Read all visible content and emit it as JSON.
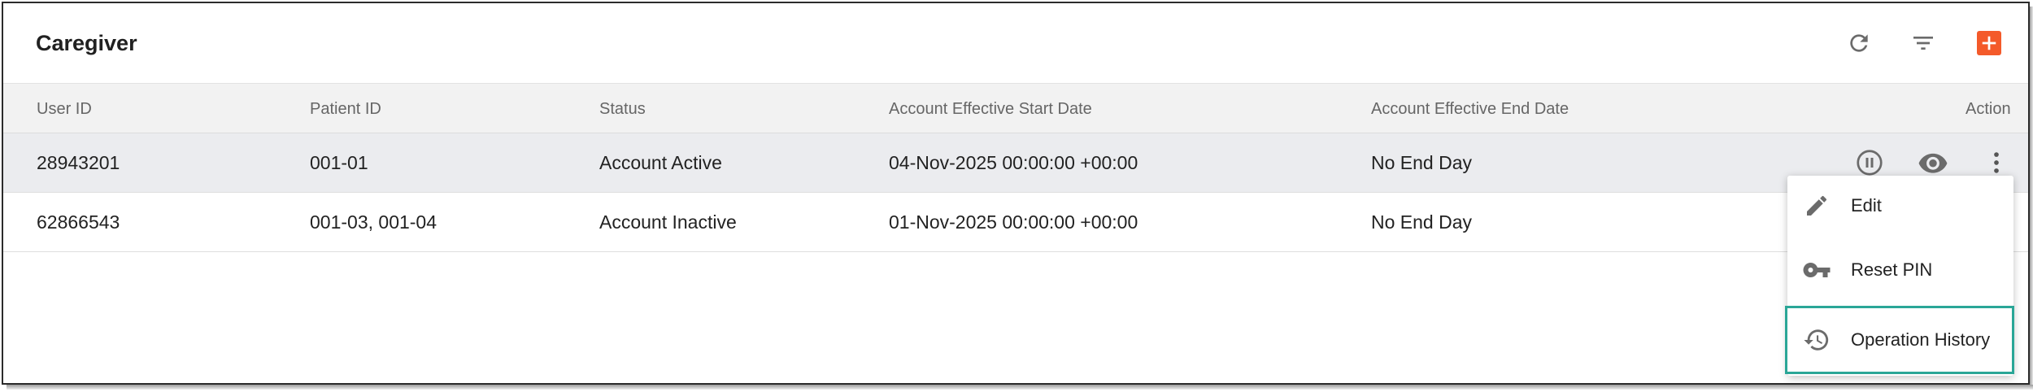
{
  "header": {
    "title": "Caregiver",
    "icons": [
      "refresh-icon",
      "filter-icon",
      "add-icon"
    ],
    "accent_color": "#f45a2a"
  },
  "table": {
    "columns": [
      "User ID",
      "Patient ID",
      "Status",
      "Account Effective Start Date",
      "Account Effective End Date",
      "Action"
    ],
    "rows": [
      {
        "user_id": "28943201",
        "patient_id": "001-01",
        "status": "Account Active",
        "start_date": "04-Nov-2025 00:00:00 +00:00",
        "end_date": "No End Day"
      },
      {
        "user_id": "62866543",
        "patient_id": "001-03, 001-04",
        "status": "Account Inactive",
        "start_date": "01-Nov-2025 00:00:00 +00:00",
        "end_date": "No End Day"
      }
    ],
    "row_action_icons": [
      "pause-icon",
      "view-icon",
      "more-vert-icon"
    ]
  },
  "action_menu": {
    "items": [
      {
        "label": "Edit",
        "icon": "pencil-icon"
      },
      {
        "label": "Reset PIN",
        "icon": "key-icon"
      },
      {
        "label": "Operation History",
        "icon": "history-icon"
      }
    ],
    "highlight_color": "#2aa697"
  }
}
